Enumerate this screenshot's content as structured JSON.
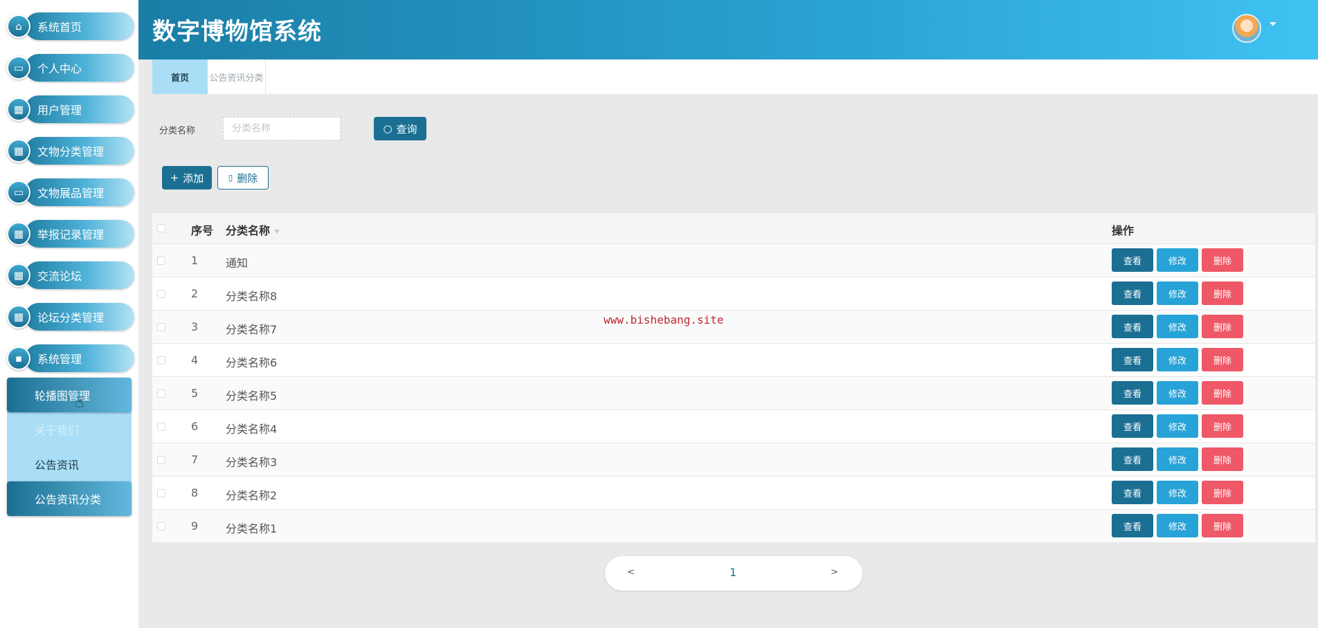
{
  "app": {
    "title": "数字博物馆系统"
  },
  "sidebar": {
    "items": [
      {
        "label": "系统首页",
        "icon": "home-icon"
      },
      {
        "label": "个人中心",
        "icon": "profile-icon"
      },
      {
        "label": "用户管理",
        "icon": "grid-icon"
      },
      {
        "label": "文物分类管理",
        "icon": "grid-icon"
      },
      {
        "label": "文物展品管理",
        "icon": "monitor-icon"
      },
      {
        "label": "举报记录管理",
        "icon": "grid-icon"
      },
      {
        "label": "交流论坛",
        "icon": "grid-icon"
      },
      {
        "label": "论坛分类管理",
        "icon": "grid-icon"
      },
      {
        "label": "系统管理",
        "icon": "chat-icon"
      }
    ],
    "submenu": [
      {
        "label": "轮播图管理"
      },
      {
        "label": "关于我们"
      },
      {
        "label": "公告资讯"
      },
      {
        "label": "公告资讯分类"
      }
    ]
  },
  "tabs": [
    {
      "label": "首页"
    },
    {
      "label": "公告资讯分类"
    }
  ],
  "search": {
    "label": "分类名称",
    "placeholder": "分类名称",
    "button": "查询"
  },
  "actions": {
    "add": "添加",
    "delete": "删除"
  },
  "table": {
    "headers": {
      "index": "序号",
      "name": "分类名称",
      "ops": "操作"
    },
    "rows": [
      {
        "index": "1",
        "name": "通知"
      },
      {
        "index": "2",
        "name": "分类名称8"
      },
      {
        "index": "3",
        "name": "分类名称7"
      },
      {
        "index": "4",
        "name": "分类名称6"
      },
      {
        "index": "5",
        "name": "分类名称5"
      },
      {
        "index": "6",
        "name": "分类名称4"
      },
      {
        "index": "7",
        "name": "分类名称3"
      },
      {
        "index": "8",
        "name": "分类名称2"
      },
      {
        "index": "9",
        "name": "分类名称1"
      }
    ],
    "row_actions": {
      "view": "查看",
      "edit": "修改",
      "delete": "删除"
    }
  },
  "watermark": "www.bishebang.site",
  "pagination": {
    "prev": "<",
    "current": "1",
    "next": ">"
  },
  "colors": {
    "primary": "#1b6f93",
    "edit": "#27a3d7",
    "danger": "#ef5867",
    "submenu_bg": "#a9def6"
  }
}
